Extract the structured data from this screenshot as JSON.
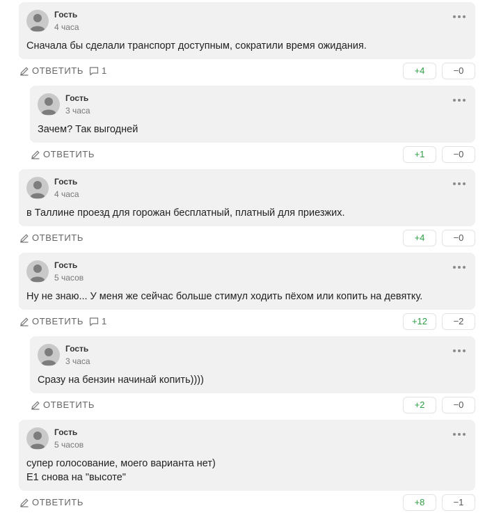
{
  "labels": {
    "reply": "ОТВЕТИТЬ"
  },
  "colors": {
    "bubble": "#f1f1f1",
    "upvote": "#2f9e44",
    "avatar": "#c9c9c9"
  },
  "comments": [
    {
      "author": "Гость",
      "time": "4 часа",
      "text": "Сначала бы сделали транспорт доступным, сократили время ожидания.",
      "replies": "1",
      "up": "+4",
      "down": "−0",
      "nested": false
    },
    {
      "author": "Гость",
      "time": "3 часа",
      "text": "Зачем? Так выгодней",
      "up": "+1",
      "down": "−0",
      "nested": true
    },
    {
      "author": "Гость",
      "time": "4 часа",
      "text": "в Таллине проезд для горожан бесплатный, платный для приезжих.",
      "up": "+4",
      "down": "−0",
      "nested": false
    },
    {
      "author": "Гость",
      "time": "5 часов",
      "text": "Ну не знаю... У меня же сейчас больше стимул ходить пёхом или копить на девятку.",
      "replies": "1",
      "up": "+12",
      "down": "−2",
      "nested": false
    },
    {
      "author": "Гость",
      "time": "3 часа",
      "text": "Сразу на бензин начинай копить))))",
      "up": "+2",
      "down": "−0",
      "nested": true
    },
    {
      "author": "Гость",
      "time": "5 часов",
      "text_lines": [
        "супер голосование, моего варианта нет)",
        "Е1 снова на \"высоте\""
      ],
      "up": "+8",
      "down": "−1",
      "nested": false
    }
  ]
}
